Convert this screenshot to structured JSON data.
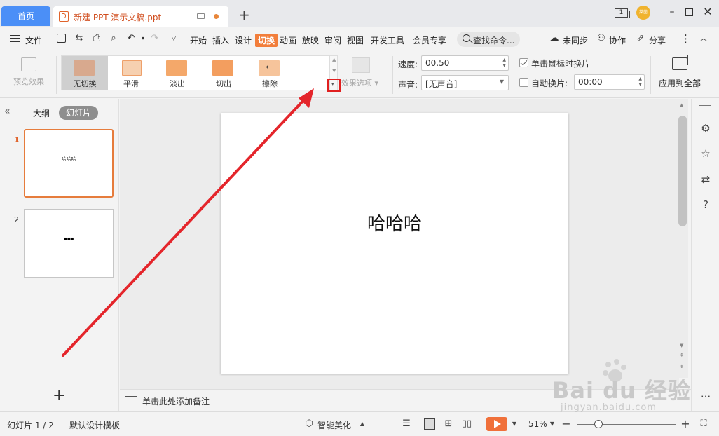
{
  "titlebar": {
    "home_tab": "首页",
    "doc_tab": "新建 PPT 演示文稿.ppt",
    "window_count": "1",
    "avatar_text": "莱茵"
  },
  "menubar": {
    "file": "文件",
    "tabs": [
      "开始",
      "插入",
      "设计",
      "切换",
      "动画",
      "放映",
      "审阅",
      "视图",
      "开发工具",
      "会员专享"
    ],
    "active_tab": "切换",
    "search": "查找命令...",
    "sync": "未同步",
    "collab": "协作",
    "share": "分享"
  },
  "ribbon": {
    "preview": "预览效果",
    "transitions": [
      {
        "label": "无切换",
        "color": "#d8a98e"
      },
      {
        "label": "平滑",
        "color": "#f2a567"
      },
      {
        "label": "淡出",
        "color": "#f4a86a"
      },
      {
        "label": "切出",
        "color": "#f39e5f"
      },
      {
        "label": "擦除",
        "color": "#f6c49b"
      }
    ],
    "selected_transition": "无切换",
    "effect_options": "效果选项",
    "speed_label": "速度:",
    "speed_value": "00.50",
    "sound_label": "声音:",
    "sound_value": "[无声音]",
    "on_click_label": "单击鼠标时换片",
    "on_click_checked": true,
    "auto_label": "自动换片:",
    "auto_checked": false,
    "auto_value": "00:00",
    "apply_all": "应用到全部"
  },
  "leftpanel": {
    "outline_tab": "大纲",
    "slides_tab": "幻灯片",
    "slides": [
      {
        "num": "1",
        "text": "哈哈哈",
        "active": true
      },
      {
        "num": "2",
        "text": "▪▪▪",
        "active": false
      }
    ]
  },
  "canvas": {
    "slide_text": "哈哈哈",
    "notes_placeholder": "单击此处添加备注"
  },
  "statusbar": {
    "slide_count": "幻灯片 1 / 2",
    "template": "默认设计模板",
    "beautify": "智能美化",
    "zoom": "51%",
    "zoom_fraction": 0.25
  },
  "watermark": {
    "brand": "Bai du 经验",
    "url": "jingyan.baidu.com"
  }
}
